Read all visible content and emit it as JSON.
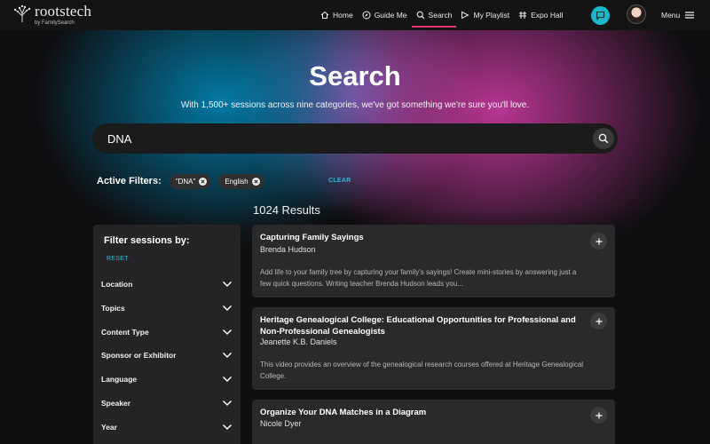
{
  "logo": {
    "name": "rootstech",
    "sub": "by FamilySearch"
  },
  "nav": [
    {
      "label": "Home",
      "icon": "home-icon"
    },
    {
      "label": "Guide Me",
      "icon": "compass-icon"
    },
    {
      "label": "Search",
      "icon": "search-icon",
      "active": true
    },
    {
      "label": "My Playlist",
      "icon": "playlist-icon"
    },
    {
      "label": "Expo Hall",
      "icon": "expo-icon"
    }
  ],
  "menu_label": "Menu",
  "hero": {
    "title": "Search",
    "subtitle": "With 1,500+ sessions across nine categories, we've got something we're sure you'll love."
  },
  "search": {
    "value": "DNA",
    "placeholder": ""
  },
  "filters": {
    "label": "Active Filters:",
    "chips": [
      "\"DNA\"",
      "English"
    ],
    "clear": "CLEAR"
  },
  "results_count": "1024 Results",
  "sidebar": {
    "title": "Filter sessions by:",
    "reset": "RESET",
    "facets": [
      "Location",
      "Topics",
      "Content Type",
      "Sponsor or Exhibitor",
      "Language",
      "Speaker",
      "Year"
    ]
  },
  "results": [
    {
      "title": "Capturing Family Sayings",
      "author": "Brenda Hudson",
      "description": "Add life to your family tree by capturing your family's sayings! Create mini-stories by answering just a few quick questions. Writing teacher Brenda Hudson leads you..."
    },
    {
      "title": "Heritage Genealogical College: Educational Opportunities for Professional and Non-Professional Genealogists",
      "author": "Jeanette K.B. Daniels",
      "description": "This video provides an overview of the genealogical research courses offered at Heritage Genealogical College."
    },
    {
      "title": "Organize Your DNA Matches in a Diagram",
      "author": "Nicole Dyer",
      "description": ""
    }
  ],
  "colors": {
    "accent": "#e5356f",
    "link": "#34b8d6",
    "chat": "#19b7c9"
  }
}
